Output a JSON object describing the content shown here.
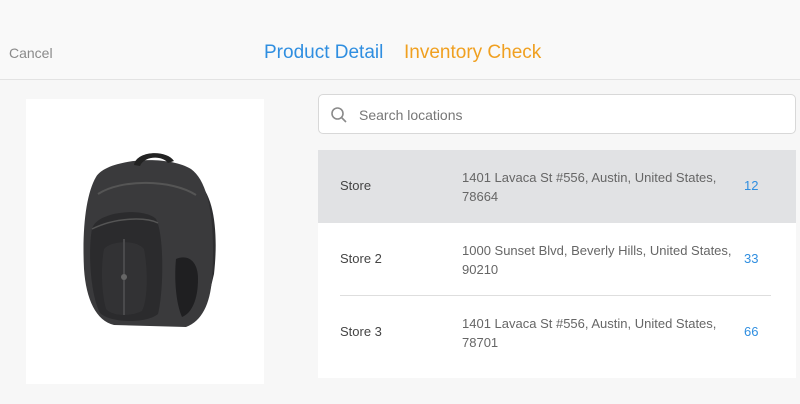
{
  "header": {
    "cancel_label": "Cancel",
    "tabs": [
      {
        "label": "Product Detail",
        "color": "#2f8ee0"
      },
      {
        "label": "Inventory Check",
        "color": "#f0a020",
        "active": true
      }
    ]
  },
  "product": {
    "image": "backpack-image"
  },
  "search": {
    "placeholder": "Search locations",
    "value": "",
    "icon": "search-icon"
  },
  "locations": [
    {
      "name": "Store",
      "address": "1401 Lavaca St #556, Austin, United States, 78664",
      "count": "12",
      "selected": true
    },
    {
      "name": "Store 2",
      "address": "1000 Sunset Blvd, Beverly Hills, United States, 90210",
      "count": "33"
    },
    {
      "name": "Store 3",
      "address": "1401 Lavaca St #556, Austin, United States, 78701",
      "count": "66"
    }
  ]
}
